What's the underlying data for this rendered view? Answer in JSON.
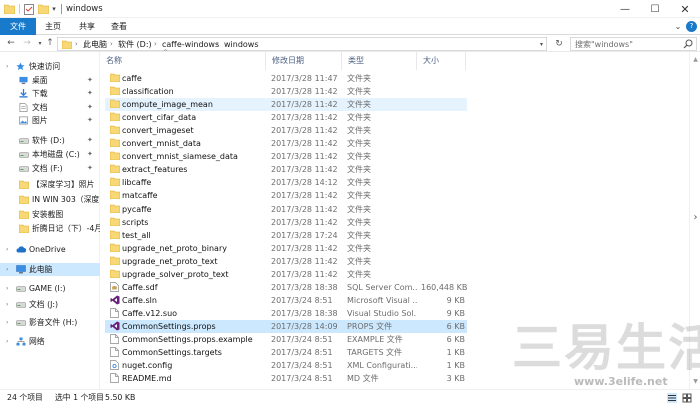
{
  "window": {
    "title": "windows",
    "min_glyph": "—",
    "max_glyph": "☐",
    "close_glyph": "✕"
  },
  "ribbon": {
    "tabs": [
      "文件",
      "主页",
      "共享",
      "查看"
    ],
    "expand_glyph": "⌄",
    "help_glyph": "?"
  },
  "nav": {
    "back_glyph": "←",
    "forward_glyph": "→",
    "recent_glyph": "▾",
    "up_glyph": "↑",
    "refresh_glyph": "↻"
  },
  "address": {
    "segments": [
      "此电脑",
      "软件 (D:)",
      "caffe-windows",
      "windows"
    ],
    "separator": "›",
    "dropdown_glyph": "▾"
  },
  "search": {
    "placeholder": "搜索\"windows\""
  },
  "sidebar": {
    "items": [
      {
        "label": "快速访问",
        "icon": "star-icon",
        "pinned": false,
        "level": 0,
        "selected": false
      },
      {
        "label": "桌面",
        "icon": "desktop-icon",
        "pinned": true,
        "level": 1,
        "selected": false
      },
      {
        "label": "下载",
        "icon": "download-icon",
        "pinned": true,
        "level": 1,
        "selected": false
      },
      {
        "label": "文档",
        "icon": "documents-icon",
        "pinned": true,
        "level": 1,
        "selected": false
      },
      {
        "label": "图片",
        "icon": "pictures-icon",
        "pinned": true,
        "level": 1,
        "selected": false
      },
      {
        "label": "软件 (D:)",
        "icon": "drive-icon",
        "pinned": true,
        "level": 1,
        "selected": false
      },
      {
        "label": "本地磁盘 (C:)",
        "icon": "drive-icon",
        "pinned": true,
        "level": 1,
        "selected": false
      },
      {
        "label": "文档 (F:)",
        "icon": "drive-icon",
        "pinned": true,
        "level": 1,
        "selected": false
      },
      {
        "label": "【深度学习】照片",
        "icon": "folder-icon",
        "pinned": false,
        "level": 1,
        "selected": false
      },
      {
        "label": "IN WIN 303（深度",
        "icon": "folder-icon",
        "pinned": false,
        "level": 1,
        "selected": false
      },
      {
        "label": "安装截图",
        "icon": "folder-icon",
        "pinned": false,
        "level": 1,
        "selected": false
      },
      {
        "label": "折腾日记（下）-4月",
        "icon": "folder-icon",
        "pinned": false,
        "level": 1,
        "selected": false
      },
      {
        "label": "OneDrive",
        "icon": "cloud-icon",
        "pinned": false,
        "level": 0,
        "selected": false
      },
      {
        "label": "此电脑",
        "icon": "computer-icon",
        "pinned": false,
        "level": 0,
        "selected": true
      },
      {
        "label": "GAME (I:)",
        "icon": "drive-icon",
        "pinned": false,
        "level": 0,
        "selected": false
      },
      {
        "label": "文档 (J:)",
        "icon": "drive-icon",
        "pinned": false,
        "level": 0,
        "selected": false
      },
      {
        "label": "影音文件 (H:)",
        "icon": "drive-icon",
        "pinned": false,
        "level": 0,
        "selected": false
      },
      {
        "label": "网络",
        "icon": "network-icon",
        "pinned": false,
        "level": 0,
        "selected": false
      }
    ],
    "pin_glyph": "📌",
    "expand_glyph": "›"
  },
  "columns": {
    "name": "名称",
    "date": "修改日期",
    "type": "类型",
    "size": "大小",
    "sort_glyph": "^"
  },
  "files": [
    {
      "name": "caffe",
      "date": "2017/3/28 11:47",
      "type": "文件夹",
      "size": "",
      "icon": "folder-icon"
    },
    {
      "name": "classification",
      "date": "2017/3/28 11:42",
      "type": "文件夹",
      "size": "",
      "icon": "folder-icon"
    },
    {
      "name": "compute_image_mean",
      "date": "2017/3/28 11:42",
      "type": "文件夹",
      "size": "",
      "icon": "folder-icon",
      "state": "hover"
    },
    {
      "name": "convert_cifar_data",
      "date": "2017/3/28 11:42",
      "type": "文件夹",
      "size": "",
      "icon": "folder-icon"
    },
    {
      "name": "convert_imageset",
      "date": "2017/3/28 11:42",
      "type": "文件夹",
      "size": "",
      "icon": "folder-icon"
    },
    {
      "name": "convert_mnist_data",
      "date": "2017/3/28 11:42",
      "type": "文件夹",
      "size": "",
      "icon": "folder-icon"
    },
    {
      "name": "convert_mnist_siamese_data",
      "date": "2017/3/28 11:42",
      "type": "文件夹",
      "size": "",
      "icon": "folder-icon"
    },
    {
      "name": "extract_features",
      "date": "2017/3/28 11:42",
      "type": "文件夹",
      "size": "",
      "icon": "folder-icon"
    },
    {
      "name": "libcaffe",
      "date": "2017/3/28 14:12",
      "type": "文件夹",
      "size": "",
      "icon": "folder-icon"
    },
    {
      "name": "matcaffe",
      "date": "2017/3/28 11:42",
      "type": "文件夹",
      "size": "",
      "icon": "folder-icon"
    },
    {
      "name": "pycaffe",
      "date": "2017/3/28 11:42",
      "type": "文件夹",
      "size": "",
      "icon": "folder-icon"
    },
    {
      "name": "scripts",
      "date": "2017/3/28 11:42",
      "type": "文件夹",
      "size": "",
      "icon": "folder-icon"
    },
    {
      "name": "test_all",
      "date": "2017/3/28 17:24",
      "type": "文件夹",
      "size": "",
      "icon": "folder-icon"
    },
    {
      "name": "upgrade_net_proto_binary",
      "date": "2017/3/28 11:42",
      "type": "文件夹",
      "size": "",
      "icon": "folder-icon"
    },
    {
      "name": "upgrade_net_proto_text",
      "date": "2017/3/28 11:42",
      "type": "文件夹",
      "size": "",
      "icon": "folder-icon"
    },
    {
      "name": "upgrade_solver_proto_text",
      "date": "2017/3/28 11:42",
      "type": "文件夹",
      "size": "",
      "icon": "folder-icon"
    },
    {
      "name": "Caffe.sdf",
      "date": "2017/3/28 18:38",
      "type": "SQL Server Com...",
      "size": "160,448 KB",
      "icon": "database-file-icon"
    },
    {
      "name": "Caffe.sln",
      "date": "2017/3/24 8:51",
      "type": "Microsoft Visual ...",
      "size": "9 KB",
      "icon": "visual-studio-icon"
    },
    {
      "name": "Caffe.v12.suo",
      "date": "2017/3/28 18:38",
      "type": "Visual Studio Sol...",
      "size": "9 KB",
      "icon": "file-icon"
    },
    {
      "name": "CommonSettings.props",
      "date": "2017/3/28 14:09",
      "type": "PROPS 文件",
      "size": "6 KB",
      "icon": "visual-studio-icon",
      "state": "selected"
    },
    {
      "name": "CommonSettings.props.example",
      "date": "2017/3/24 8:51",
      "type": "EXAMPLE 文件",
      "size": "6 KB",
      "icon": "file-icon"
    },
    {
      "name": "CommonSettings.targets",
      "date": "2017/3/24 8:51",
      "type": "TARGETS 文件",
      "size": "1 KB",
      "icon": "file-icon"
    },
    {
      "name": "nuget.config",
      "date": "2017/3/24 8:51",
      "type": "XML Configurati...",
      "size": "1 KB",
      "icon": "config-file-icon"
    },
    {
      "name": "README.md",
      "date": "2017/3/24 8:51",
      "type": "MD 文件",
      "size": "3 KB",
      "icon": "file-icon"
    }
  ],
  "status": {
    "count": "24 个项目",
    "selection": "选中 1 个项目",
    "size": "5.50 KB"
  },
  "scrollbar": {
    "up_glyph": "▲",
    "right_glyph": "›",
    "down_glyph": "▼"
  },
  "watermark": {
    "text": "三易生活",
    "url": "www.3elife.net"
  },
  "colors": {
    "accent": "#1979ca",
    "selection": "#cce8ff",
    "hover": "#e5f3ff",
    "folder": "#f8d775"
  }
}
